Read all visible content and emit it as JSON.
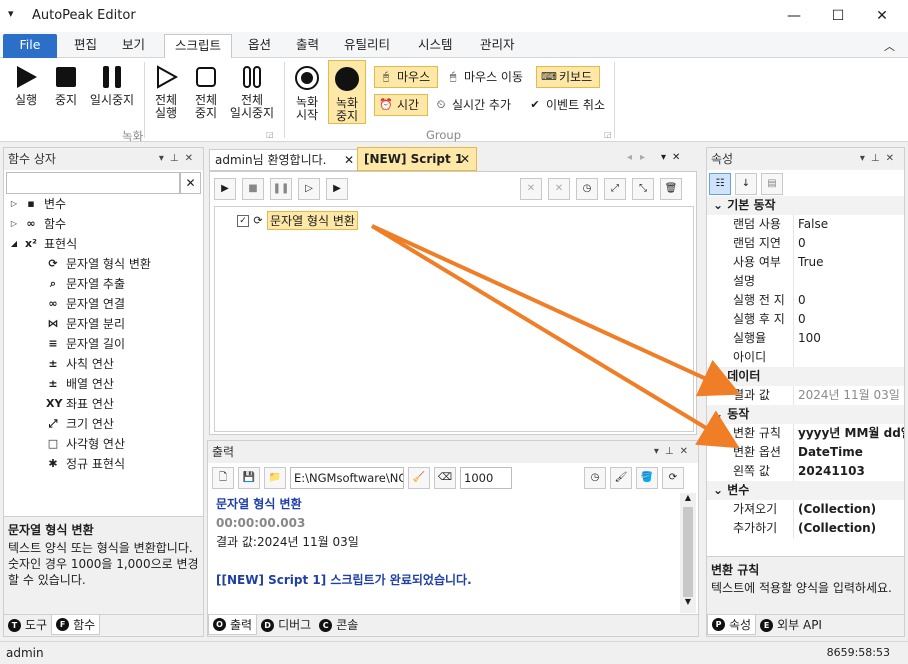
{
  "window": {
    "title": "AutoPeak Editor",
    "minimize": "—",
    "maximize": "☐",
    "close": "✕",
    "quick_access": "▾"
  },
  "menu": [
    "File",
    "편집",
    "보기",
    "스크립트",
    "옵션",
    "출력",
    "유틸리티",
    "시스템",
    "관리자"
  ],
  "ribbon": {
    "run": "실행",
    "stop": "중지",
    "pause": "일시중지",
    "run_all_1": "전체",
    "run_all_2": "실행",
    "stop_all_1": "전체",
    "stop_all_2": "중지",
    "pause_all_1": "전체",
    "pause_all_2": "일시중지",
    "group_record": "녹화",
    "rec_start_1": "녹화",
    "rec_start_2": "시작",
    "rec_stop_1": "녹화",
    "rec_stop_2": "중지",
    "mouse": "마우스",
    "mouse_move": "마우스 이동",
    "keyboard": "키보드",
    "time": "시간",
    "realtime_add": "실시간 추가",
    "event_cancel": "이벤트 취소",
    "group_group": "Group"
  },
  "left_panel": {
    "title": "함수 상자",
    "search_placeholder": "",
    "tree": [
      {
        "label": "변수",
        "level": 0,
        "icon": "variable-icon",
        "glyph": "▪"
      },
      {
        "label": "함수",
        "level": 0,
        "icon": "function-icon",
        "glyph": "∞"
      },
      {
        "label": "표현식",
        "level": 0,
        "icon": "expression-icon",
        "glyph": "x²"
      },
      {
        "label": "문자열 형식 변환",
        "level": 1,
        "icon": "format-convert-icon",
        "glyph": "⟳"
      },
      {
        "label": "문자열 추출",
        "level": 1,
        "icon": "extract-icon",
        "glyph": "⌕"
      },
      {
        "label": "문자열 연결",
        "level": 1,
        "icon": "link-icon",
        "glyph": "∞"
      },
      {
        "label": "문자열 분리",
        "level": 1,
        "icon": "split-icon",
        "glyph": "⋈"
      },
      {
        "label": "문자열 길이",
        "level": 1,
        "icon": "length-icon",
        "glyph": "≡"
      },
      {
        "label": "사칙 연산",
        "level": 1,
        "icon": "arithmetic-icon",
        "glyph": "±"
      },
      {
        "label": "배열 연산",
        "level": 1,
        "icon": "array-icon",
        "glyph": "±"
      },
      {
        "label": "좌표 연산",
        "level": 1,
        "icon": "coordinate-icon",
        "glyph": "XY"
      },
      {
        "label": "크기 연산",
        "level": 1,
        "icon": "size-icon",
        "glyph": "⤢"
      },
      {
        "label": "사각형 연산",
        "level": 1,
        "icon": "rectangle-icon",
        "glyph": "□"
      },
      {
        "label": "정규 표현식",
        "level": 1,
        "icon": "regex-icon",
        "glyph": "✱"
      }
    ],
    "desc_title": "문자열 형식 변환",
    "desc_text": "텍스트 양식 또는 형식을 변환합니다. 숫자인 경우 1000을 1,000으로 변경할 수 있습니다.",
    "tabs": [
      {
        "key": "T",
        "label": "도구"
      },
      {
        "key": "F",
        "label": "함수"
      }
    ]
  },
  "doc": {
    "tabs": [
      {
        "label": "admin님 환영합니다.",
        "close": "✕"
      },
      {
        "label": "[NEW] Script 1",
        "close": "✕"
      }
    ],
    "node_label": "문자열 형식 변환"
  },
  "output_panel": {
    "title": "출력",
    "path": "E:\\NGMsoftware\\NG",
    "number": "1000",
    "lines": [
      {
        "text": "문자열 형식 변환",
        "color": "#1f3fa8",
        "bold": true
      },
      {
        "text": "00:00:00.003",
        "color": "#888888",
        "bold": true
      },
      {
        "text": "결과 값:2024년 11월 03일",
        "color": "#1e1e1e",
        "bold": false
      },
      {
        "text": "",
        "color": "#1e1e1e",
        "bold": false
      },
      {
        "text": "[[NEW] Script 1] 스크립트가 완료되었습니다.",
        "color": "#1f3fa8",
        "bold": true
      }
    ],
    "tabs": [
      {
        "key": "O",
        "label": "출력"
      },
      {
        "key": "D",
        "label": "디버그"
      },
      {
        "key": "C",
        "label": "콘솔"
      }
    ]
  },
  "props_panel": {
    "title": "속성",
    "categories": [
      {
        "name": "기본 동작",
        "rows": [
          {
            "k": "랜덤 사용",
            "v": "False",
            "bold": false,
            "gray": false
          },
          {
            "k": "랜덤 지연",
            "v": "0",
            "bold": false,
            "gray": false
          },
          {
            "k": "사용 여부",
            "v": "True",
            "bold": false,
            "gray": false
          },
          {
            "k": "설명",
            "v": "",
            "bold": false,
            "gray": false
          },
          {
            "k": "실행 전 지",
            "v": "0",
            "bold": false,
            "gray": false
          },
          {
            "k": "실행 후 지",
            "v": "0",
            "bold": false,
            "gray": false
          },
          {
            "k": "실행율",
            "v": "100",
            "bold": false,
            "gray": false
          },
          {
            "k": "아이디",
            "v": "",
            "bold": false,
            "gray": false
          }
        ]
      },
      {
        "name": "데이터",
        "rows": [
          {
            "k": "결과 값",
            "v": "2024년 11월 03일",
            "bold": false,
            "gray": true
          }
        ]
      },
      {
        "name": "동작",
        "rows": [
          {
            "k": "변환 규칙",
            "v": "yyyy년 MM월 dd일",
            "bold": true,
            "gray": false
          },
          {
            "k": "변환 옵션",
            "v": "DateTime",
            "bold": true,
            "gray": false
          },
          {
            "k": "왼쪽 값",
            "v": "20241103",
            "bold": true,
            "gray": false
          }
        ]
      },
      {
        "name": "변수",
        "rows": [
          {
            "k": "가져오기",
            "v": "(Collection)",
            "bold": true,
            "gray": false
          },
          {
            "k": "추가하기",
            "v": "(Collection)",
            "bold": true,
            "gray": false
          }
        ]
      }
    ],
    "desc_title": "변환 규칙",
    "desc_text": "텍스트에 적용할 양식을 입력하세요.",
    "tabs": [
      {
        "key": "P",
        "label": "속성"
      },
      {
        "key": "E",
        "label": "외부 API"
      }
    ]
  },
  "status": {
    "user": "admin",
    "time": "8659:58:53"
  },
  "colors": {
    "accent": "#2b6fc9",
    "highlight": "#fde8a8",
    "arrow": "#f07e26"
  }
}
